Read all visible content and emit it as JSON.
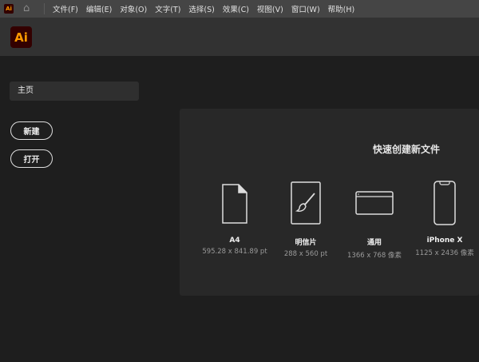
{
  "menubar": {
    "app_badge": "Ai",
    "items": [
      "文件(F)",
      "编辑(E)",
      "对象(O)",
      "文字(T)",
      "选择(S)",
      "效果(C)",
      "视图(V)",
      "窗口(W)",
      "帮助(H)"
    ]
  },
  "header": {
    "logo": "Ai"
  },
  "sidebar": {
    "home": "主页",
    "new_button": "新建",
    "open_button": "打开"
  },
  "quick_create": {
    "title": "快速创建新文件",
    "presets": [
      {
        "name": "A4",
        "size": "595.28 x 841.89 pt",
        "icon": "document-icon"
      },
      {
        "name": "明信片",
        "size": "288 x 560 pt",
        "icon": "brush-icon"
      },
      {
        "name": "通用",
        "size": "1366 x 768 像素",
        "icon": "browser-window-icon"
      },
      {
        "name": "iPhone X",
        "size": "1125 x 2436 像素",
        "icon": "phone-icon"
      }
    ]
  },
  "colors": {
    "brand_bg": "#330000",
    "brand_fg": "#ff9a00"
  }
}
